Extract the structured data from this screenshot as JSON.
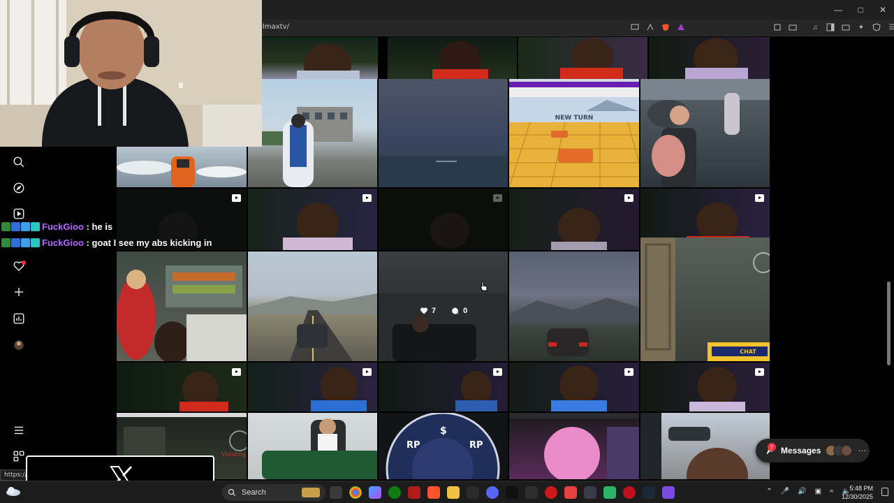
{
  "browser": {
    "url": "elmaxtv/",
    "window_controls": [
      "minimize",
      "maximize",
      "close"
    ]
  },
  "chat": {
    "messages": [
      {
        "user": "FuckGioo",
        "separator": " : ",
        "text": "he is"
      },
      {
        "user": "FuckGioo",
        "separator": " : ",
        "text": "goat I see my abs kicking in"
      }
    ],
    "user_color": "#b565ff"
  },
  "post_stats": {
    "likes": "7",
    "comments": "0"
  },
  "messages_pill": {
    "label": "Messages",
    "unread": "7"
  },
  "status_bar": {
    "url": "https://w"
  },
  "taskbar": {
    "search_label": "Search",
    "time": "5:48 PM",
    "date": "12/30/2025"
  },
  "colors": {
    "accent_red": "#ff3040",
    "chat_user": "#b565ff"
  }
}
